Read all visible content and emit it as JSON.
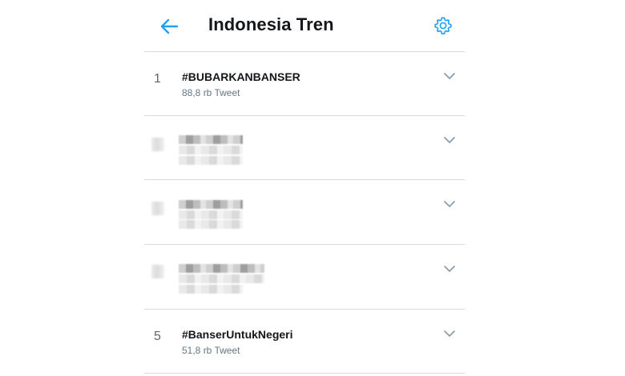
{
  "header": {
    "title": "Indonesia Tren",
    "back_icon": "arrow-left-icon",
    "settings_icon": "gear-icon",
    "accent_color": "#1da1f2"
  },
  "trends": [
    {
      "rank": "1",
      "hashtag": "#BUBARKANBANSER",
      "tweet_count": "88,8 rb Tweet",
      "redacted": false
    },
    {
      "rank": "",
      "hashtag": "",
      "tweet_count": "",
      "redacted": true
    },
    {
      "rank": "",
      "hashtag": "",
      "tweet_count": "",
      "redacted": true
    },
    {
      "rank": "",
      "hashtag": "",
      "tweet_count": "",
      "redacted": true
    },
    {
      "rank": "5",
      "hashtag": "#BanserUntukNegeri",
      "tweet_count": "51,8 rb Tweet",
      "redacted": false
    }
  ],
  "icons": {
    "row_menu": "chevron-down-icon"
  },
  "colors": {
    "divider": "#d6dbe0",
    "text_primary": "#14171a",
    "text_secondary": "#657786"
  }
}
